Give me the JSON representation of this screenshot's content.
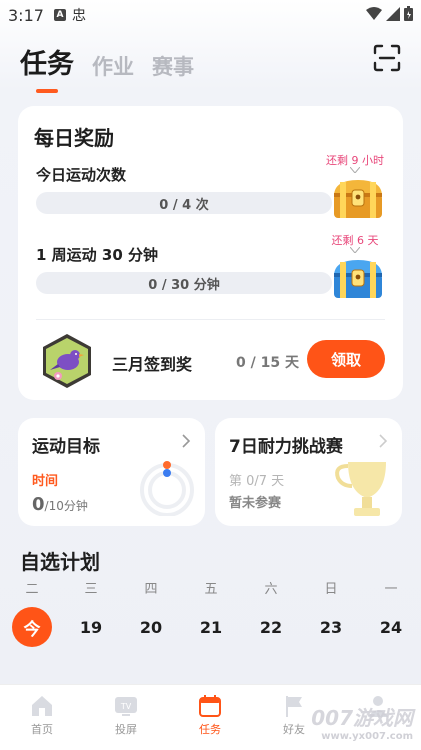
{
  "status_bar": {
    "time": "3:17",
    "icon_a": "A",
    "icon_c": "忠"
  },
  "header": {
    "tabs": [
      {
        "label": "任务"
      },
      {
        "label": "作业"
      },
      {
        "label": "赛事"
      }
    ],
    "scan_icon": "scan-icon"
  },
  "daily": {
    "title": "每日奖励",
    "tasks": [
      {
        "label": "今日运动次数",
        "progress_text": "0 / 4 次",
        "remain": "还剩 9 小时"
      },
      {
        "label": "1 周运动 30 分钟",
        "progress_text": "0 / 30 分钟",
        "remain": "还剩 6 天"
      }
    ],
    "checkin": {
      "label": "三月签到奖",
      "count": "0 / 15 天",
      "button": "领取"
    }
  },
  "goal_card": {
    "title": "运动目标",
    "sub": "时间",
    "value": "0",
    "unit": "/10分钟"
  },
  "challenge_card": {
    "title": "7日耐力挑战赛",
    "sub1": "第 0/7 天",
    "sub2": "暂未参赛"
  },
  "plan": {
    "title": "自选计划",
    "days": [
      {
        "day": "二",
        "num": "今"
      },
      {
        "day": "三",
        "num": "19"
      },
      {
        "day": "四",
        "num": "20"
      },
      {
        "day": "五",
        "num": "21"
      },
      {
        "day": "六",
        "num": "22"
      },
      {
        "day": "日",
        "num": "23"
      },
      {
        "day": "一",
        "num": "24"
      }
    ]
  },
  "nav": [
    {
      "label": "首页",
      "icon": "home-icon"
    },
    {
      "label": "投屏",
      "icon": "tv-icon"
    },
    {
      "label": "任务",
      "icon": "calendar-icon"
    },
    {
      "label": "好友",
      "icon": "flag-icon"
    },
    {
      "label": "",
      "icon": "profile-icon"
    }
  ],
  "watermark": {
    "brand": "007游戏网",
    "url": "www.yx007.com"
  },
  "colors": {
    "accent": "#ff5417",
    "remain": "#e8477a"
  }
}
